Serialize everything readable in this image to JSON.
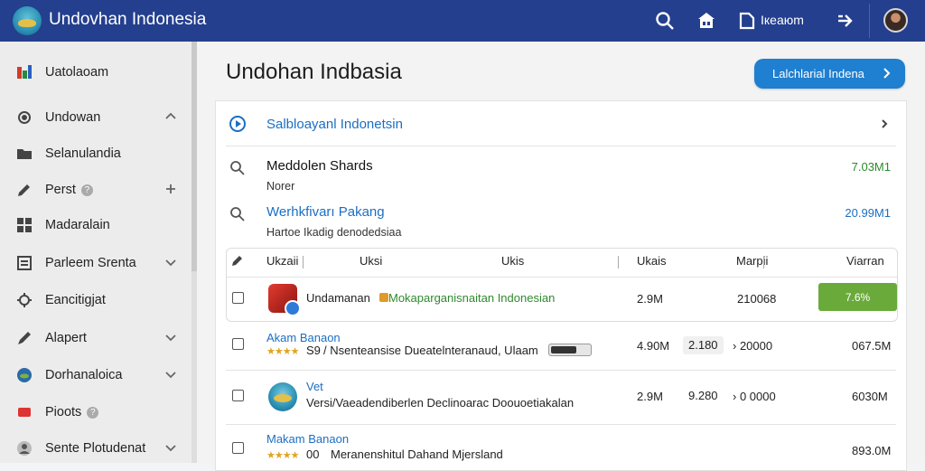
{
  "topbar": {
    "title": "Undovhan Indonesia",
    "user_label": "Ікеаюm"
  },
  "sidebar": {
    "items": [
      {
        "label": "Uatolaoam",
        "icon": "apps-icon"
      },
      {
        "label": "Undowan",
        "icon": "gear-icon"
      },
      {
        "label": "Selanulandia",
        "icon": "folder-icon"
      },
      {
        "label": "Perst",
        "icon": "pencil-icon"
      },
      {
        "label": "Madaralain",
        "icon": "grid-icon"
      },
      {
        "label": "Parleem Srenta",
        "icon": "list-icon"
      },
      {
        "label": "Eancitigjat",
        "icon": "settings-icon"
      },
      {
        "label": "Alapert",
        "icon": "pen-icon"
      },
      {
        "label": "Dorhanaloica",
        "icon": "globe-icon"
      },
      {
        "label": "Pioots",
        "icon": "tag-icon"
      },
      {
        "label": "Sente Plotudenat",
        "icon": "user-icon"
      }
    ]
  },
  "main": {
    "page_title": "Undohan Indbasia",
    "cta_label": "Lalchlarial Indena",
    "section_title": "Salbloayanl Indonetsin",
    "results": [
      {
        "title": "Meddolen Shards",
        "subtitle": "Norer",
        "amount": "7.03M1",
        "amount_color": "#2c8a2c"
      },
      {
        "title": "Werhkfivarı Pakang",
        "subtitle": "Hartoe Ikadig denodedsiaa",
        "amount": "20.99M1",
        "amount_color": "#1b6fc3"
      }
    ],
    "table": {
      "headers": [
        "Ukzaii",
        "Uksi",
        "Ukis",
        "Ukais",
        "Marpii",
        "Viarran"
      ],
      "rows": [
        {
          "name": "Undamanan",
          "desc": "Mokaparganisnaitan Indonesian",
          "v1": "2.9M",
          "v2": "210068",
          "button": "7.6%"
        },
        {
          "title": "Akam Banaon",
          "rating": "★★★★",
          "score": "S9",
          "desc": "/ Nsenteansise Dueatelnteranaud, Ulaam",
          "v1": "4.90M",
          "v2": "2.180",
          "v3": "› 20000",
          "v4": "067.5M"
        },
        {
          "title": "Vet",
          "desc": "Versi/Vaeadendiberlen Declinoarac Doouoetiakalan",
          "v1": "2.9M",
          "v2": "9.280",
          "v3": "› 0 0000",
          "v4": "6030M"
        },
        {
          "title": "Makam Banaon",
          "rating": "★★★★",
          "score": "00",
          "desc": "Meranenshitul Dahand Mjersland",
          "v4": "893.0M"
        }
      ]
    }
  },
  "colors": {
    "topbar": "#243f8e",
    "accent": "#1f7fd0",
    "link": "#1b6fc3",
    "success": "#6aaa3a"
  }
}
